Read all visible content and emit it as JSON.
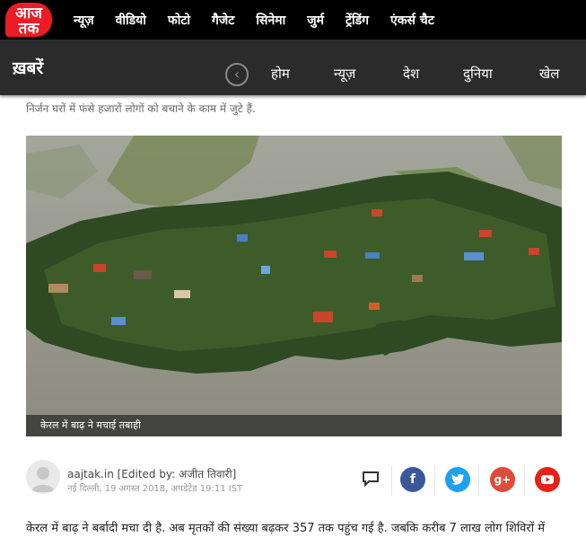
{
  "topbar": {
    "logo_text": "आज तक",
    "nav": [
      "न्यूज़",
      "वीडियो",
      "फोटो",
      "गैजेट",
      "सिनेमा",
      "जुर्म",
      "ट्रेंडिंग",
      "एंकर्स चैट"
    ]
  },
  "section": {
    "title": "ख़बरें",
    "nav": [
      "होम",
      "न्यूज़",
      "देश",
      "दुनिया",
      "खेल"
    ]
  },
  "article": {
    "excerpt": "निर्जन घरों में फंसे हजारों लोगों को बचाने के काम में जुटे हैं.",
    "photo_caption": "केरल में बाढ़ ने मचाई तबाही",
    "author": "aajtak.in [Edited by: अजीत तिवारी]",
    "meta": "नई दिल्ली, 19 अगस्त 2018, अपडेटेड 19:11 IST",
    "body": "केरल में बाढ़ ने बर्बादी मचा दी है. अब मृतकों की संख्या बढ़कर 357 तक पहुंच गई है. जबकि करीब 7 लाख लोग शिविरों में"
  },
  "share": {
    "facebook_color": "#3b5998",
    "twitter_color": "#1da1f2",
    "googleplus_color": "#dd4b39",
    "youtube_color": "#e62117"
  }
}
